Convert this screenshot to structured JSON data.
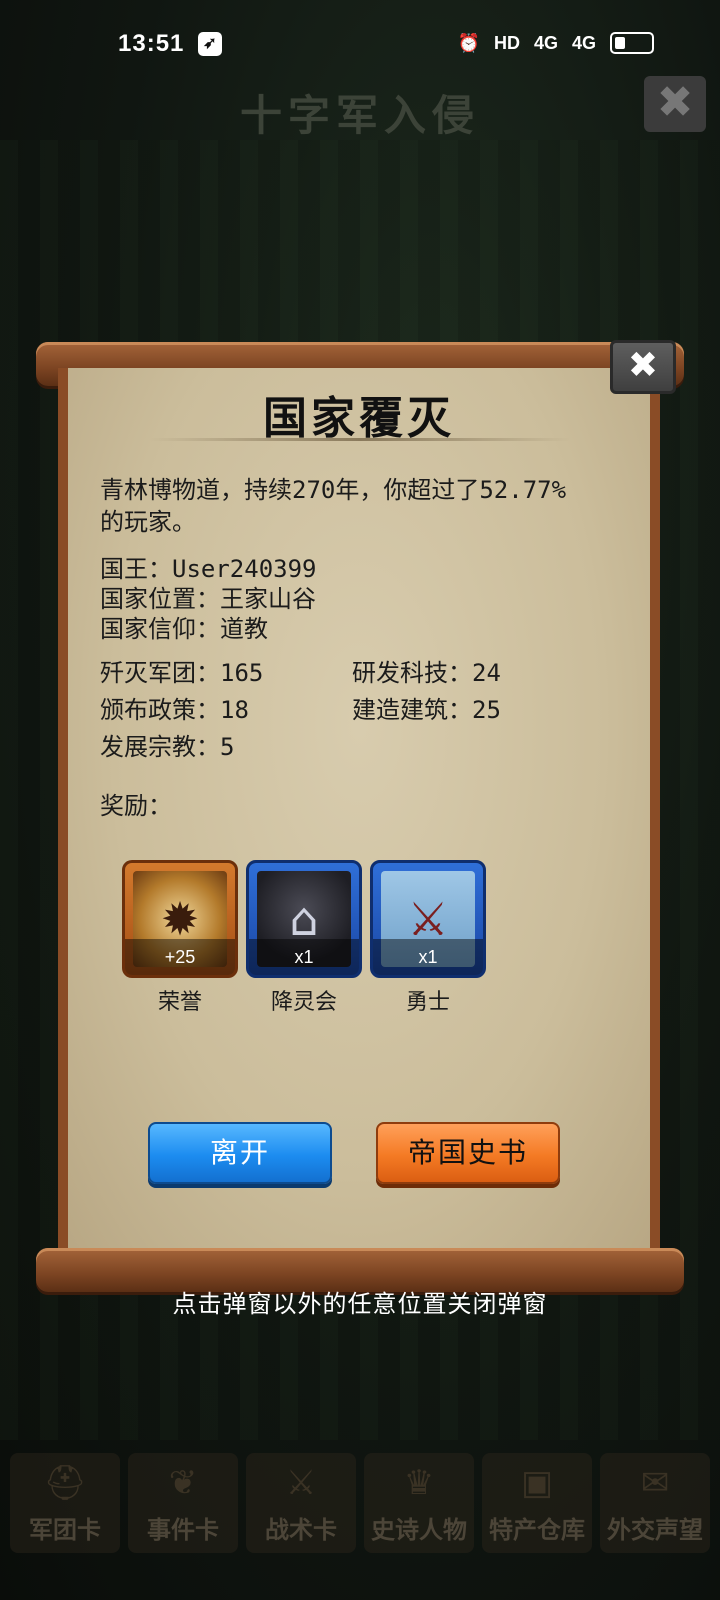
{
  "status_bar": {
    "time": "13:51",
    "icons": [
      "app-notification-icon",
      "alarm-icon",
      "hd-icon",
      "signal-4g-icon",
      "signal-4g-icon",
      "battery-icon"
    ],
    "hd_label": "HD",
    "net1": "4G",
    "net2": "4G"
  },
  "header": {
    "title": "十字军入侵",
    "close_symbol": "✖"
  },
  "dialog": {
    "title": "国家覆灭",
    "close_symbol": "✖",
    "summary": "青林博物道，持续270年，你超过了52.77%的玩家。",
    "king": "国王：User240399",
    "location": "国家位置：王家山谷",
    "faith": "国家信仰：道教",
    "stats": {
      "destroyed_legions": "歼灭军团：165",
      "research": "研发科技：24",
      "policies": "颁布政策：18",
      "buildings": "建造建筑：25",
      "religion": "发展宗教：5"
    },
    "rewards_label": "奖励：",
    "rewards": [
      {
        "name": "荣誉",
        "count": "+25",
        "icon": "honor-medal-icon",
        "color": "orange"
      },
      {
        "name": "降灵会",
        "count": "x1",
        "icon": "haunted-manor-icon",
        "color": "blue"
      },
      {
        "name": "勇士",
        "count": "x1",
        "icon": "warrior-icon",
        "color": "blue"
      }
    ],
    "buttons": {
      "leave": "离开",
      "history": "帝国史书"
    }
  },
  "hint": "点击弹窗以外的任意位置关闭弹窗",
  "bottom_nav": [
    {
      "label": "军团卡",
      "icon": "helmet-icon"
    },
    {
      "label": "事件卡",
      "icon": "scroll-icon"
    },
    {
      "label": "战术卡",
      "icon": "crossed-swords-icon"
    },
    {
      "label": "史诗人物",
      "icon": "crown-icon"
    },
    {
      "label": "特产仓库",
      "icon": "chest-icon"
    },
    {
      "label": "外交声望",
      "icon": "letter-icon"
    }
  ]
}
